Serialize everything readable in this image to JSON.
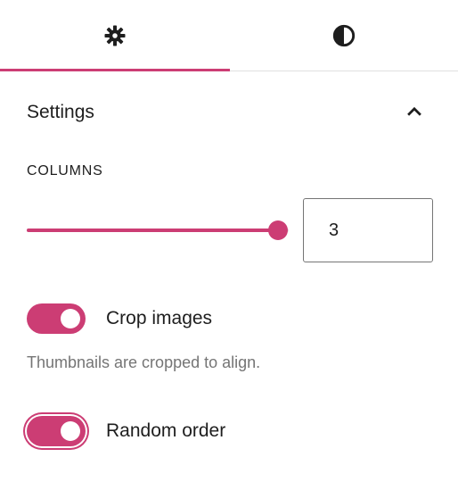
{
  "tabs": [
    {
      "name": "settings",
      "icon": "gear-icon",
      "active": true
    },
    {
      "name": "styles",
      "icon": "contrast-icon",
      "active": false
    }
  ],
  "panel": {
    "title": "Settings",
    "collapse_icon": "chevron-up-icon"
  },
  "columns": {
    "label": "COLUMNS",
    "value": "3",
    "slider_fraction": 1.0
  },
  "crop_images": {
    "label": "Crop images",
    "on": true,
    "help": "Thumbnails are cropped to align."
  },
  "random_order": {
    "label": "Random order",
    "on": true,
    "focused": true
  },
  "colors": {
    "accent": "#cc3d74",
    "text": "#1e1e1e",
    "muted": "#757575",
    "divider": "#e0e0e0"
  }
}
